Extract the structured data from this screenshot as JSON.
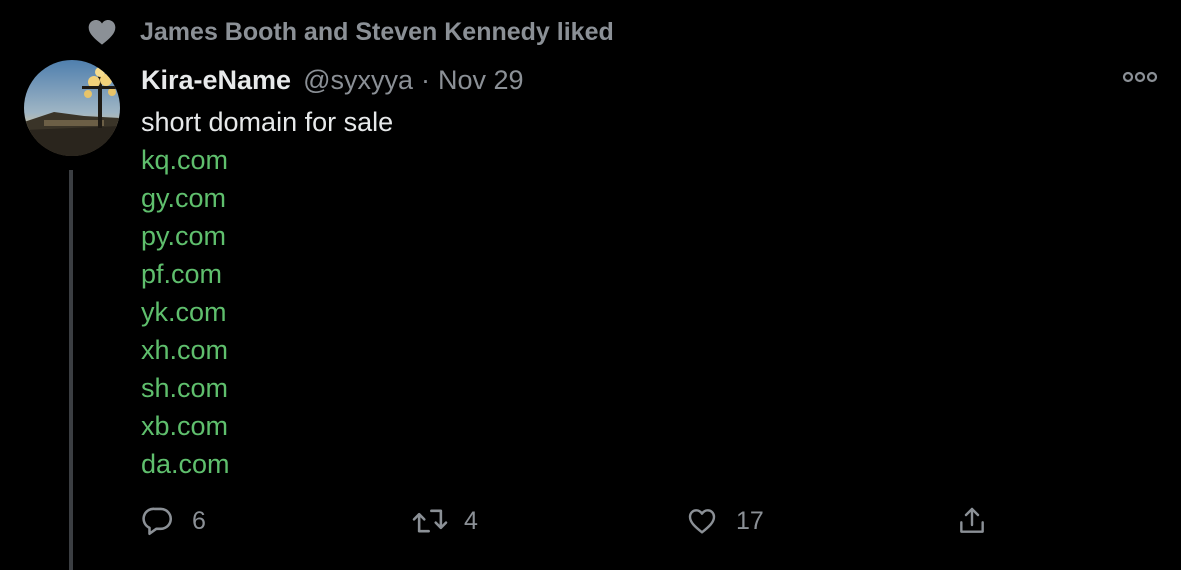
{
  "context": {
    "icon": "heart-icon",
    "text": "James Booth and Steven Kennedy liked"
  },
  "tweet": {
    "author": {
      "display_name": "Kira-eName",
      "handle": "@syxyya",
      "avatar": "avatar-photo"
    },
    "separator": "·",
    "timestamp": "Nov 29",
    "more_icon": "more-icon",
    "text_lines": [
      "short domain for sale",
      "kq.com",
      "gy.com",
      "py.com",
      "pf.com",
      "yk.com",
      "xh.com",
      "sh.com",
      "xb.com",
      "da.com"
    ],
    "link_color": "#5fbf6d",
    "actions": {
      "reply": {
        "icon": "reply-icon",
        "count": "6"
      },
      "retweet": {
        "icon": "retweet-icon",
        "count": "4"
      },
      "like": {
        "icon": "like-icon",
        "count": "17"
      },
      "share": {
        "icon": "share-icon"
      }
    }
  },
  "colors": {
    "background": "#000000",
    "primary_text": "#e7e9ea",
    "secondary_text": "#8b9096",
    "link": "#5fbf6d",
    "thread_line": "#3b3e42"
  }
}
